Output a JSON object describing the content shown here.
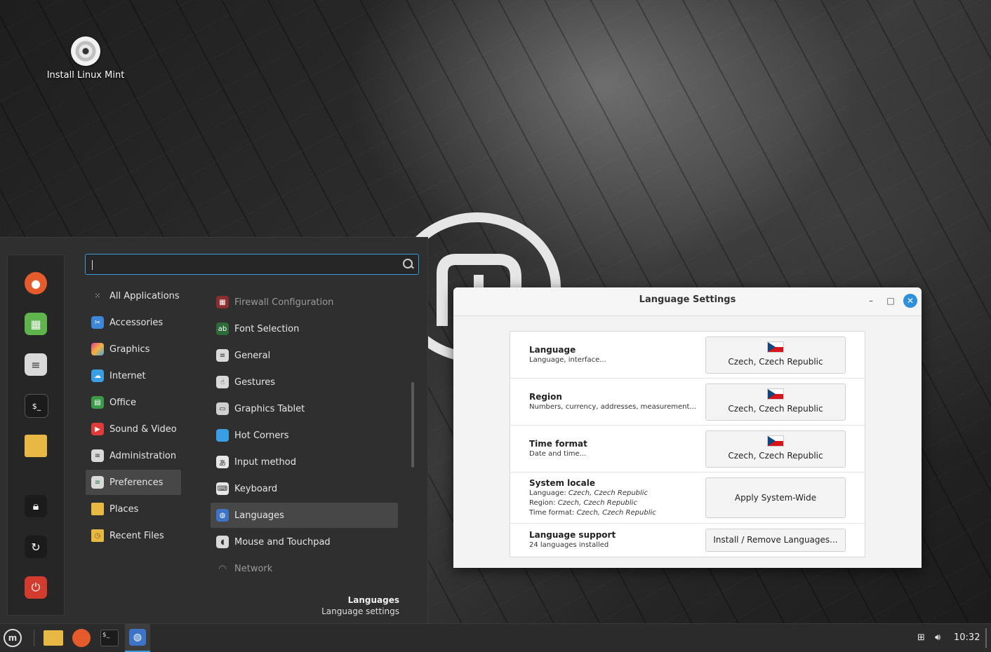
{
  "desktop": {
    "icon_label": "Install Linux Mint"
  },
  "menu": {
    "search": {
      "value": "",
      "placeholder": ""
    },
    "categories": [
      {
        "label": "All Applications"
      },
      {
        "label": "Accessories"
      },
      {
        "label": "Graphics"
      },
      {
        "label": "Internet"
      },
      {
        "label": "Office"
      },
      {
        "label": "Sound & Video"
      },
      {
        "label": "Administration"
      },
      {
        "label": "Preferences"
      },
      {
        "label": "Places"
      },
      {
        "label": "Recent Files"
      }
    ],
    "apps": [
      {
        "label": "Firewall Configuration"
      },
      {
        "label": "Font Selection"
      },
      {
        "label": "General"
      },
      {
        "label": "Gestures"
      },
      {
        "label": "Graphics Tablet"
      },
      {
        "label": "Hot Corners"
      },
      {
        "label": "Input method"
      },
      {
        "label": "Keyboard"
      },
      {
        "label": "Languages"
      },
      {
        "label": "Mouse and Touchpad"
      },
      {
        "label": "Network"
      }
    ],
    "description": {
      "title": "Languages",
      "subtitle": "Language settings"
    }
  },
  "window": {
    "title": "Language Settings",
    "rows": {
      "language": {
        "title": "Language",
        "subtitle": "Language, interface...",
        "value": "Czech, Czech Republic"
      },
      "region": {
        "title": "Region",
        "subtitle": "Numbers, currency, addresses, measurement...",
        "value": "Czech, Czech Republic"
      },
      "time_format": {
        "title": "Time format",
        "subtitle": "Date and time...",
        "value": "Czech, Czech Republic"
      },
      "system_locale": {
        "title": "System locale",
        "language_label": "Language:",
        "language_value": "Czech, Czech Republic",
        "region_label": "Region:",
        "region_value": "Czech, Czech Republic",
        "time_label": "Time format:",
        "time_value": "Czech, Czech Republic",
        "button": "Apply System-Wide"
      },
      "language_support": {
        "title": "Language support",
        "subtitle": "24 languages installed",
        "button": "Install / Remove Languages..."
      }
    }
  },
  "taskbar": {
    "clock": "10:32"
  },
  "colors": {
    "accent": "#3b9ad9",
    "close": "#2e8fdb",
    "flag_red": "#d7141a",
    "flag_blue": "#11457e"
  }
}
